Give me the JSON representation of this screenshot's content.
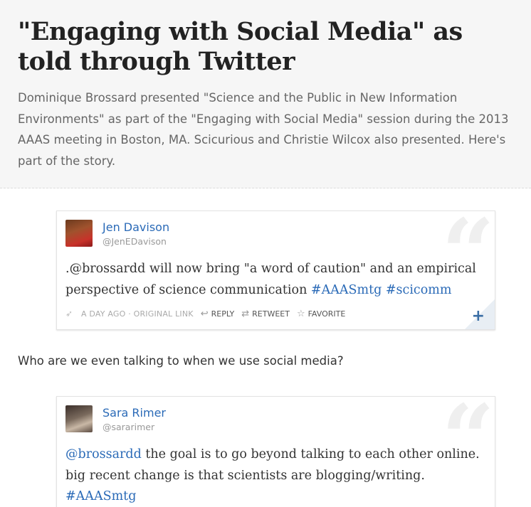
{
  "story": {
    "title": "\"Engaging with Social Media\" as told through Twitter",
    "description": "Dominique Brossard presented \"Science and the Public in New Information Environments\" as part of the \"Engaging with Social Media\" session during the 2013 AAAS meeting in Boston, MA. Scicurious and Christie Wilcox also presented. Here's part of the story."
  },
  "tweets": [
    {
      "name": "Jen Davison",
      "handle": "@JenEDavison",
      "text_parts": [
        ".@brossardd will now bring \"a word of caution\" and an empirical perspective of science communication ",
        "#AAASmtg",
        " ",
        "#scicomm"
      ],
      "timestamp": "A DAY AGO",
      "original_link": "ORIGINAL LINK",
      "reply_label": "REPLY",
      "retweet_label": "RETWEET",
      "favorite_label": "FAVORITE",
      "expand_label": "+"
    },
    {
      "name": "Sara Rimer",
      "handle": "@sararimer",
      "text_parts": [
        "@brossardd",
        " the goal is to go beyond talking to each other online. big recent change is that scientists are blogging/writing. ",
        "#AAASmtg"
      ]
    }
  ],
  "caption": "Who are we even talking to when we use social media?",
  "icons": {
    "quote": "quote-icon",
    "bird": "twitter-bird-icon",
    "reply": "reply-icon",
    "retweet": "retweet-icon",
    "favorite": "star-icon"
  },
  "colors": {
    "link": "#2a6ab7",
    "header_bg": "#f6f6f6"
  }
}
